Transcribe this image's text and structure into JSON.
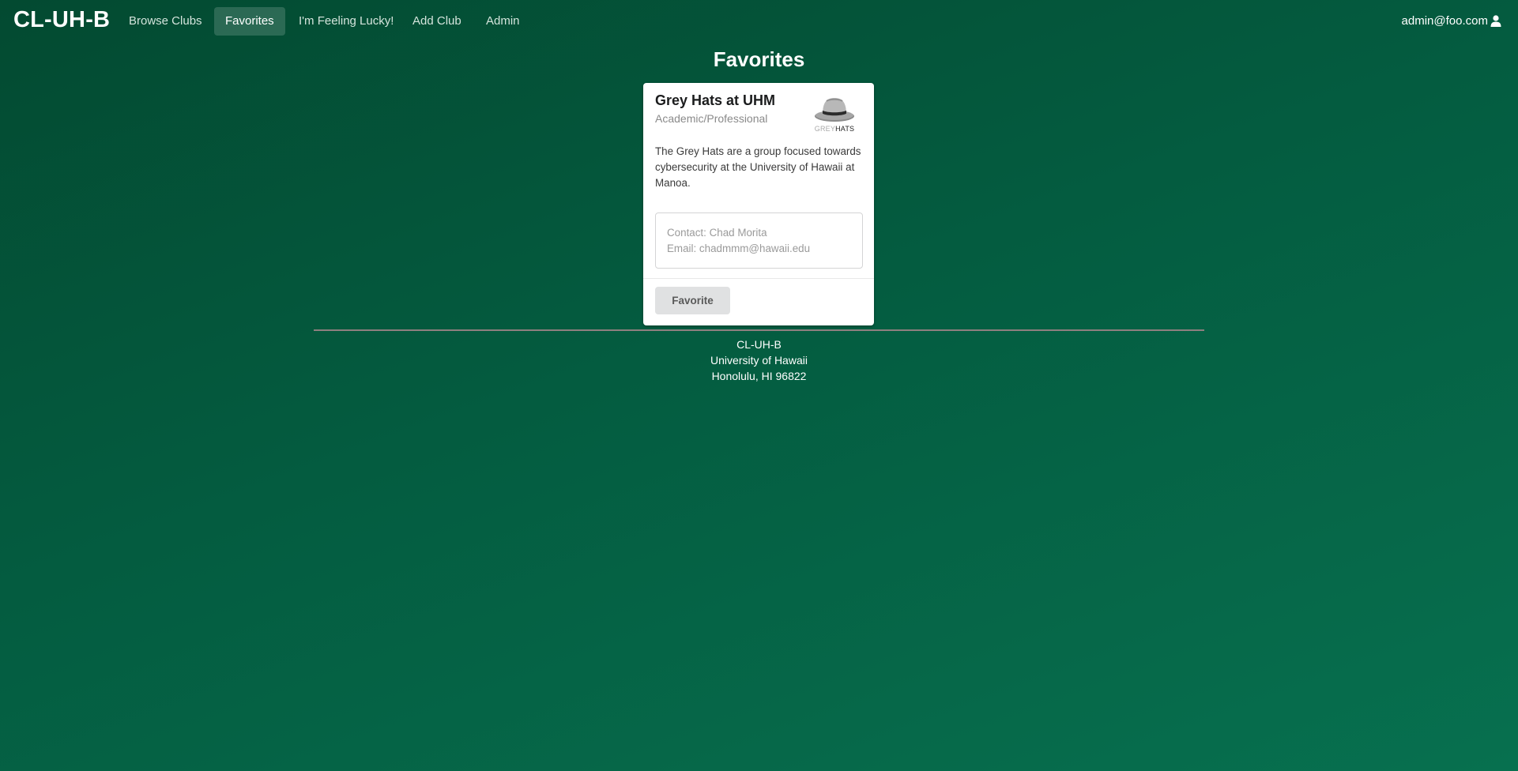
{
  "navbar": {
    "brand": "CL-UH-B",
    "items": [
      {
        "label": "Browse Clubs"
      },
      {
        "label": "Favorites"
      },
      {
        "label": "I'm Feeling Lucky!"
      },
      {
        "label": "Add Club"
      },
      {
        "label": "Admin"
      }
    ],
    "user_email": "admin@foo.com"
  },
  "page": {
    "title": "Favorites"
  },
  "club_card": {
    "name": "Grey Hats at UHM",
    "category": "Academic/Professional",
    "logo_text_grey": "GREY",
    "logo_text_dark": "HATS",
    "description": "The Grey Hats are a group focused towards cybersecurity at the University of Hawaii at Manoa.",
    "contact": "Contact: Chad Morita",
    "email": "Email: chadmmm@hawaii.edu",
    "favorite_label": "Favorite"
  },
  "footer": {
    "line1": "CL-UH-B",
    "line2": "University of Hawaii",
    "line3": "Honolulu, HI 96822"
  },
  "colors": {
    "background_start": "#034a31",
    "background_end": "#07704f",
    "active_nav": "rgba(255,255,255,0.16)"
  },
  "icons": {
    "user": "user-icon",
    "logo": "grey-hat-logo-icon"
  }
}
